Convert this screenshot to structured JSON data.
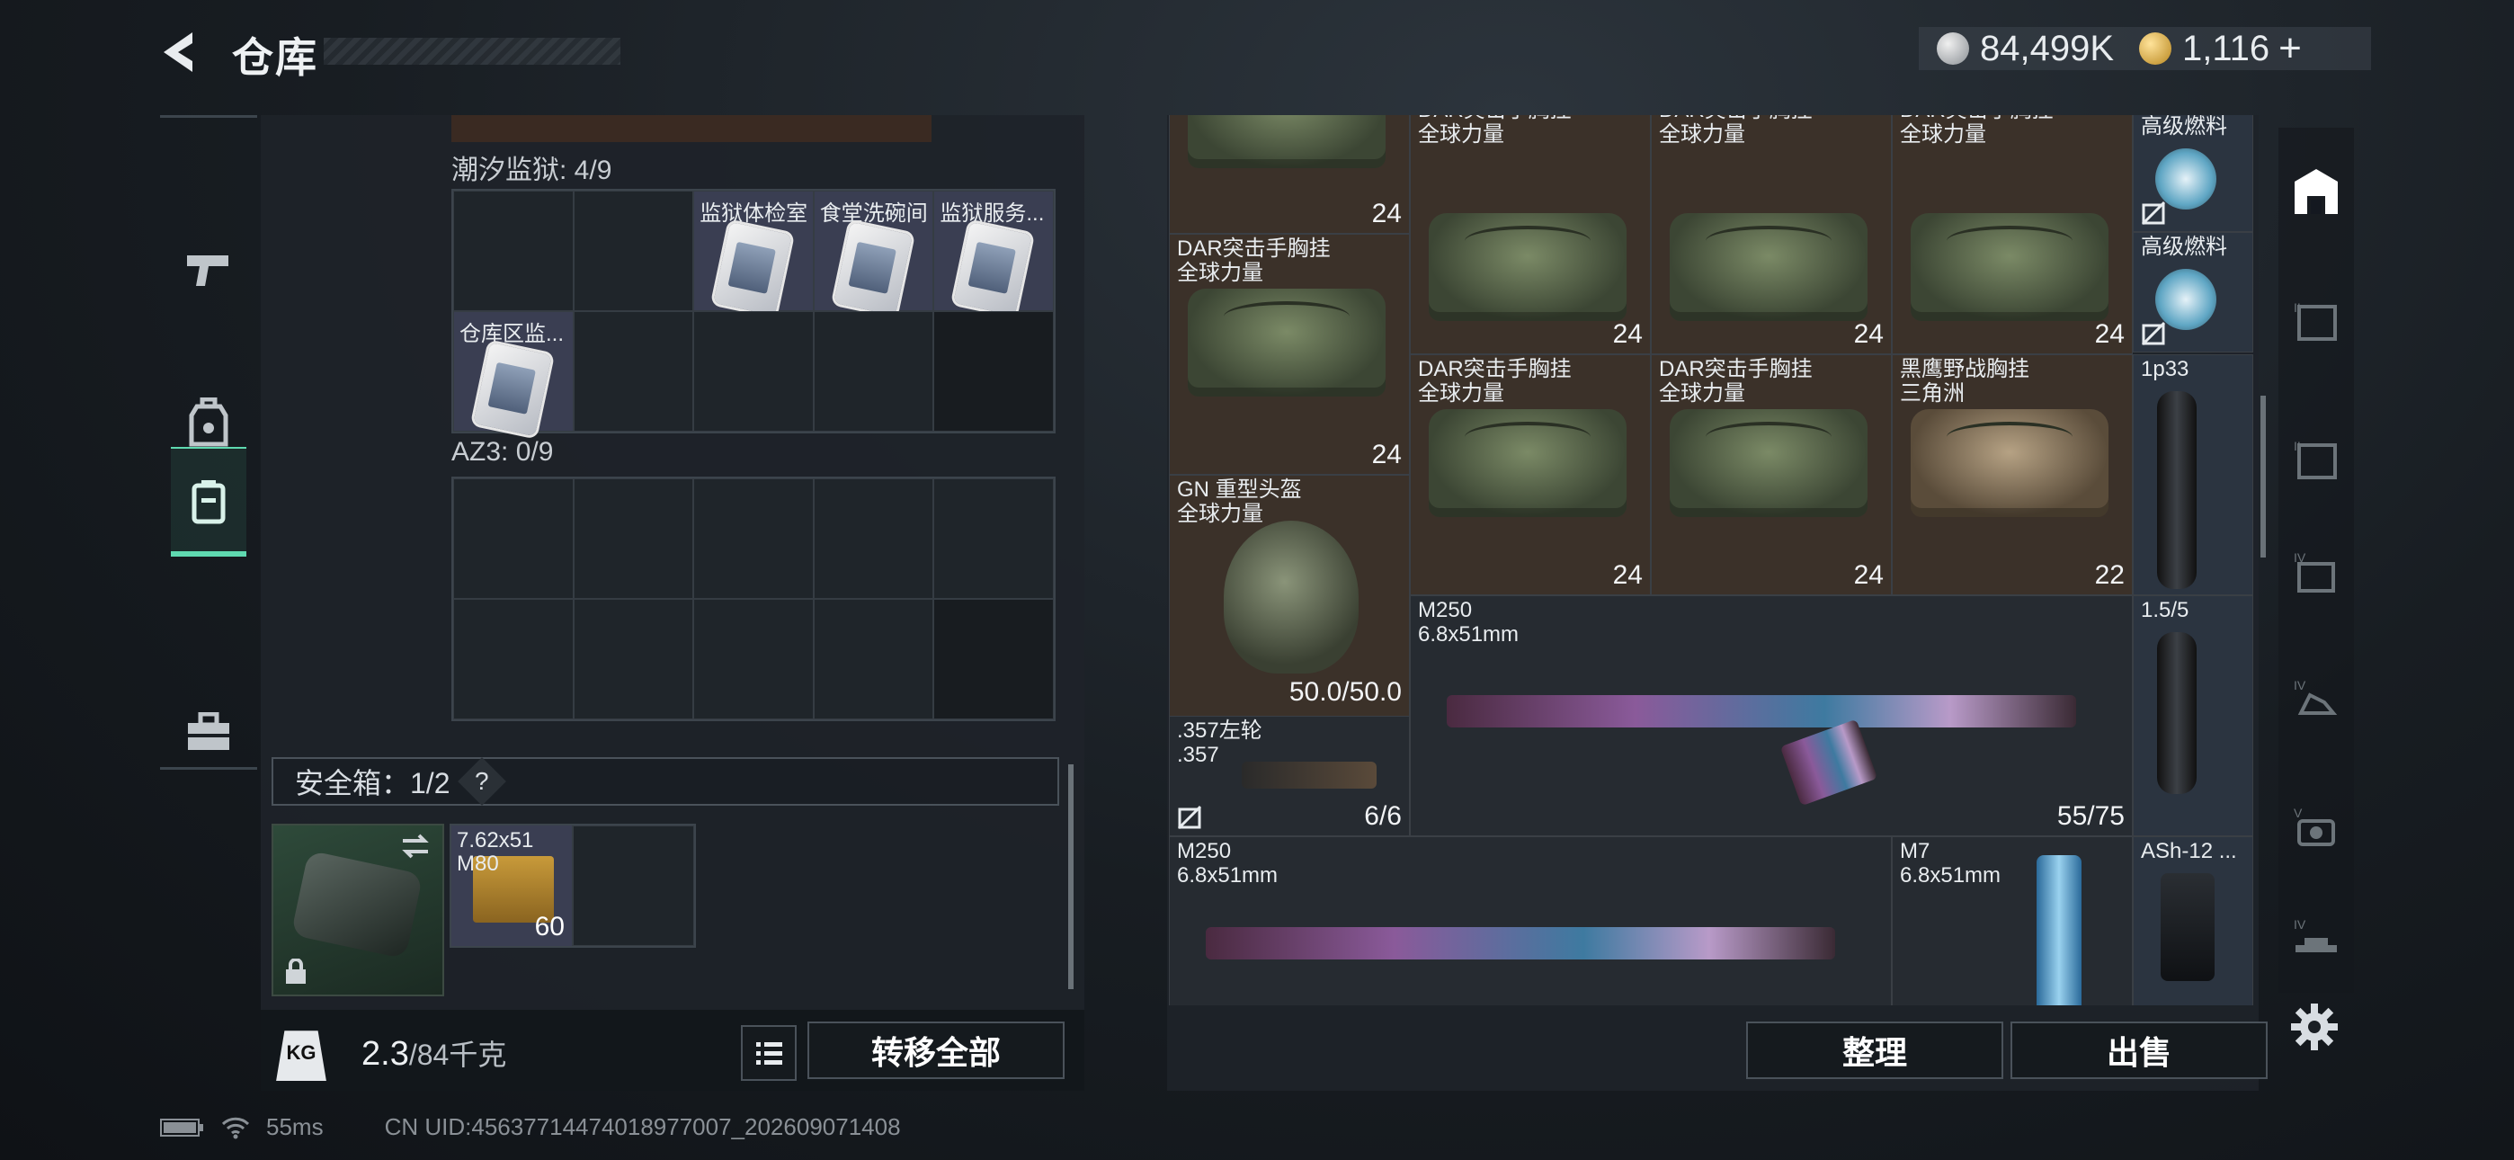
{
  "header": {
    "title": "仓库",
    "back_icon": "back-chevron-icon"
  },
  "currency": {
    "coins": "84,499K",
    "premium": "1,116",
    "add": "+"
  },
  "left_nav": {
    "items": [
      {
        "name": "weapons",
        "icon": "pistol-icon"
      },
      {
        "name": "gear",
        "icon": "backpack-icon"
      },
      {
        "name": "containers",
        "icon": "case-icon",
        "active": true
      },
      {
        "name": "toolbox",
        "icon": "toolbox-icon"
      }
    ]
  },
  "stash": {
    "keys_label": "潮汐监狱: 4/9",
    "keys_row1": [
      "",
      "",
      "监狱体检室",
      "食堂洗碗间",
      "监狱服务..."
    ],
    "keys_row2": [
      "仓库区监...",
      "",
      "",
      "",
      ""
    ],
    "az3_label": "AZ3: 0/9",
    "safe_label": "安全箱：1/2",
    "safe_help": "?",
    "ammo": {
      "name": "7.62x51\nM80",
      "count": "60"
    },
    "weight": "2.3",
    "weight_max": "/84千克",
    "kg_badge": "KG",
    "transfer_all": "转移全部"
  },
  "inventory": {
    "items": [
      {
        "name": "",
        "count": "24"
      },
      {
        "name": "DAR突击手胸挂\n全球力量",
        "count": ""
      },
      {
        "name": "DAR突击手胸挂\n全球力量",
        "count": ""
      },
      {
        "name": "DAR突击手胸挂\n全球力量",
        "count": ""
      },
      {
        "name": "高级燃料",
        "count": ""
      },
      {
        "name": "DAR突击手胸挂\n全球力量",
        "count": "24"
      },
      {
        "name": "",
        "count": "24"
      },
      {
        "name": "",
        "count": "24"
      },
      {
        "name": "",
        "count": "24"
      },
      {
        "name": "高级燃料",
        "count": ""
      },
      {
        "name": "DAR突击手胸挂\n全球力量",
        "count": "24"
      },
      {
        "name": "DAR突击手胸挂\n全球力量",
        "count": "24"
      },
      {
        "name": "黑鹰野战胸挂\n三角洲",
        "count": "22"
      },
      {
        "name": "1p33",
        "count": ""
      },
      {
        "name": "GN 重型头盔\n全球力量",
        "count": "50.0/50.0"
      },
      {
        "name": "M250\n6.8x51mm",
        "count": "55/75"
      },
      {
        "name": "1.5/5",
        "count": ""
      },
      {
        "name": ".357左轮\n.357",
        "count": "6/6"
      },
      {
        "name": "M250\n6.8x51mm",
        "count": ""
      },
      {
        "name": "M7\n6.8x51mm",
        "count": ""
      },
      {
        "name": "ASh-12 ...",
        "count": ""
      }
    ],
    "sort": "整理",
    "sell": "出售"
  },
  "right_rail": {
    "tabs": [
      "building-icon",
      "II-icon",
      "II-icon",
      "IV-icon",
      "IV-icon",
      "V-icon",
      "IV-icon"
    ],
    "settings_icon": "gear-icon"
  },
  "status": {
    "ping": "55ms",
    "uid": "CN UID:45637714474018977007_202609071408"
  }
}
